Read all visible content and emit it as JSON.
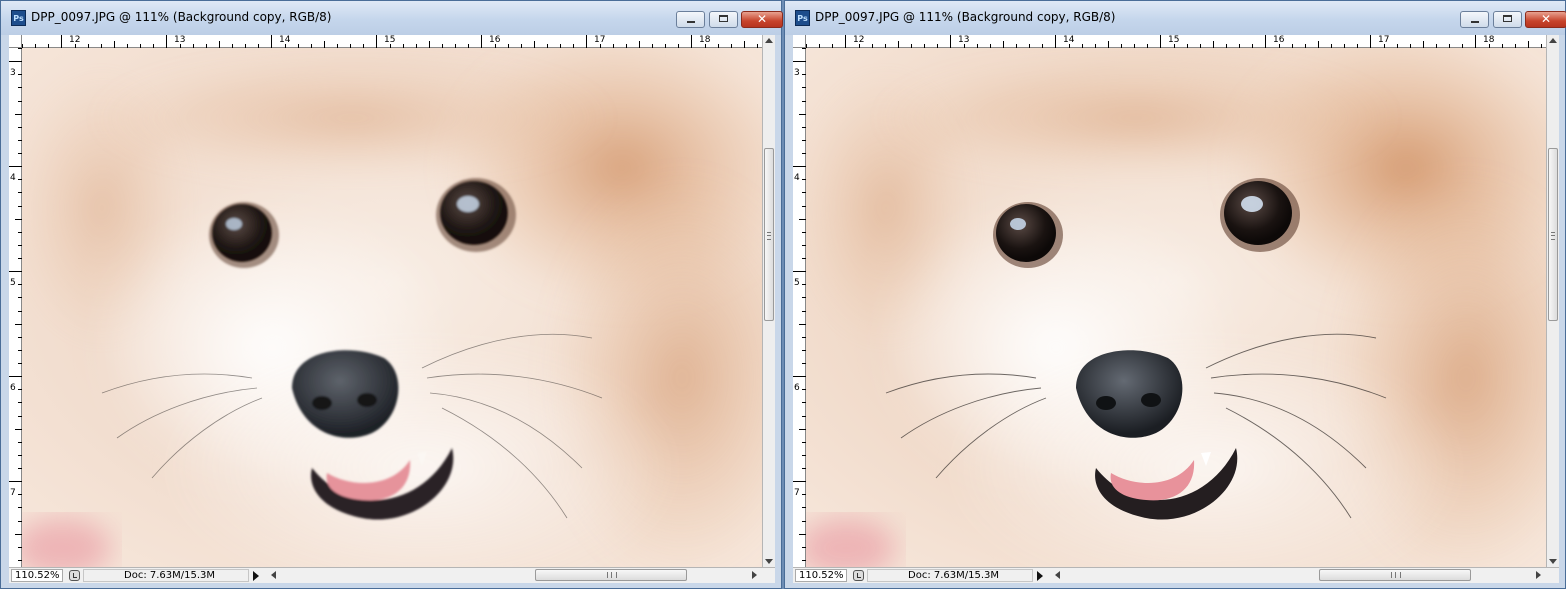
{
  "windows": [
    {
      "title": "DPP_0097.JPG @ 111% (Background copy, RGB/8)",
      "ruler_top_labels": [
        "12",
        "13",
        "14",
        "15",
        "16",
        "17",
        "18"
      ],
      "ruler_left_labels": [
        "3",
        "4",
        "5",
        "6",
        "7"
      ],
      "zoom": "110.52%",
      "doc_info": "Doc: 7.63M/15.3M",
      "image": {
        "content": "pomeranian-dog-face",
        "sharpened": false
      }
    },
    {
      "title": "DPP_0097.JPG @ 111% (Background copy, RGB/8)",
      "ruler_top_labels": [
        "12",
        "13",
        "14",
        "15",
        "16",
        "17",
        "18"
      ],
      "ruler_left_labels": [
        "3",
        "4",
        "5",
        "6",
        "7"
      ],
      "zoom": "110.52%",
      "doc_info": "Doc: 7.63M/15.3M",
      "image": {
        "content": "pomeranian-dog-face",
        "sharpened": true
      }
    }
  ],
  "icons": {
    "app": "photoshop-icon",
    "minimize": "minimize-icon",
    "maximize": "maximize-icon",
    "close": "close-icon",
    "status": "document-status-icon",
    "menu": "status-menu-arrow-icon"
  },
  "colors": {
    "title_bar": "#c5d6ec",
    "close_button": "#c7432b",
    "fur_light": "#f6e9de",
    "fur_orange": "#d9a07a",
    "nose": "#2b2f35",
    "tongue": "#e6939b"
  }
}
